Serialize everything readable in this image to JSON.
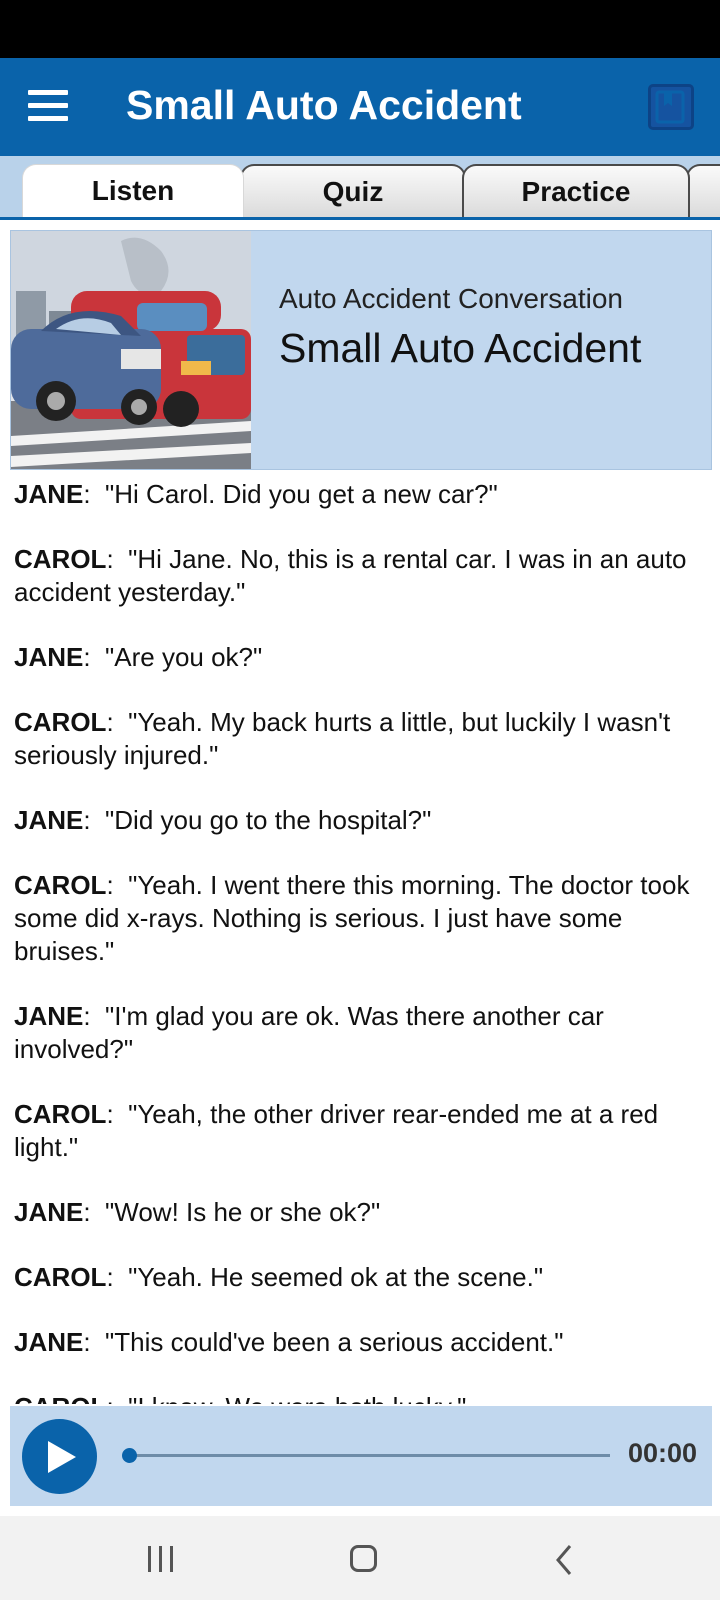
{
  "app_bar": {
    "title": "Small Auto Accident",
    "menu_icon": "hamburger-menu-icon",
    "bookmark_icon": "book-icon"
  },
  "tabs": [
    {
      "label": "Listen",
      "active": true
    },
    {
      "label": "Quiz",
      "active": false
    },
    {
      "label": "Practice",
      "active": false
    }
  ],
  "lesson": {
    "image": "car-accident-illustration",
    "subtitle": "Auto Accident Conversation",
    "title": "Small Auto Accident"
  },
  "dialogue": [
    {
      "speaker": "JANE",
      "text": "\"Hi Carol.  Did you get a new car?\""
    },
    {
      "speaker": "CAROL",
      "text": "\"Hi Jane.  No, this is a rental car.  I was in an auto accident yesterday.\""
    },
    {
      "speaker": "JANE",
      "text": "\"Are you ok?\""
    },
    {
      "speaker": "CAROL",
      "text": "\"Yeah.  My back hurts a little, but luckily I wasn't seriously injured.\""
    },
    {
      "speaker": "JANE",
      "text": "\"Did you go to the hospital?\""
    },
    {
      "speaker": "CAROL",
      "text": "\"Yeah.  I went there this morning.  The doctor took some did x-rays.  Nothing is serious.  I just have some bruises.\""
    },
    {
      "speaker": "JANE",
      "text": "\"I'm glad you are ok.  Was there another car involved?\""
    },
    {
      "speaker": "CAROL",
      "text": "\"Yeah, the other driver rear-ended me at a red light.\""
    },
    {
      "speaker": "JANE",
      "text": "\"Wow!  Is he or she ok?\""
    },
    {
      "speaker": "CAROL",
      "text": "\"Yeah.  He seemed ok at the scene.\""
    },
    {
      "speaker": "JANE",
      "text": "\"This could've been a serious accident.\""
    },
    {
      "speaker": "CAROL",
      "text": "\"I know.  We were both lucky.\""
    }
  ],
  "player": {
    "play_icon": "play-icon",
    "time": "00:00",
    "progress": 0
  },
  "system_nav": {
    "recents_icon": "recents-icon",
    "home_icon": "home-icon",
    "back_icon": "back-icon"
  },
  "colors": {
    "brand": "#0a63aa",
    "panel": "#c1d7ee"
  }
}
